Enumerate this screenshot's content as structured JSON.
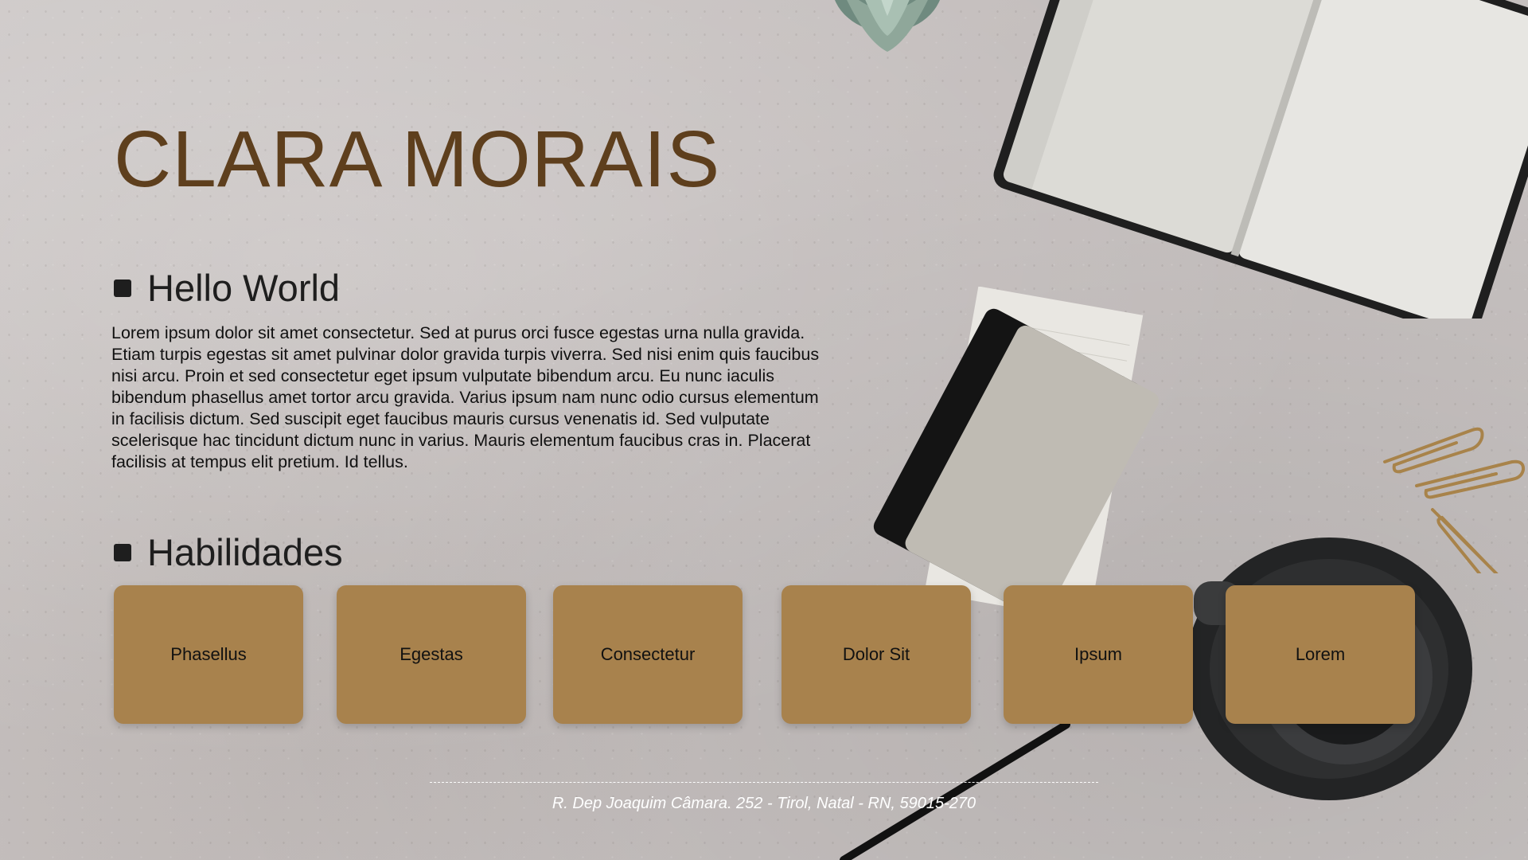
{
  "header": {
    "name": "CLARA MORAIS"
  },
  "about": {
    "title": "Hello World",
    "text": "Lorem ipsum dolor sit amet consectetur. Sed at purus orci fusce egestas urna nulla gravida. Etiam turpis egestas sit amet pulvinar dolor gravida turpis viverra. Sed nisi enim quis faucibus nisi arcu. Proin et sed consectetur eget ipsum vulputate bibendum arcu. Eu nunc iaculis bibendum phasellus amet tortor arcu gravida. Varius ipsum nam nunc odio cursus elementum in facilisis dictum. Sed suscipit eget faucibus mauris cursus venenatis id. Sed vulputate scelerisque hac tincidunt dictum nunc in varius. Mauris elementum faucibus cras in. Placerat facilisis at tempus elit pretium. Id tellus."
  },
  "skills": {
    "title": "Habilidades",
    "items": [
      "Phasellus",
      "Egestas",
      "Consectetur",
      "Dolor Sit",
      "Ipsum",
      "Lorem"
    ]
  },
  "footer": {
    "address": "R. Dep Joaquim Câmara. 252 - Tirol, Natal - RN, 59015-270"
  },
  "colors": {
    "name": "#5e3f1d",
    "card": "#a8824d",
    "text": "#111111"
  },
  "decor_icons": [
    "succulent-plant",
    "open-notebook",
    "notepad",
    "paperclips",
    "coffee-cup",
    "pen"
  ]
}
